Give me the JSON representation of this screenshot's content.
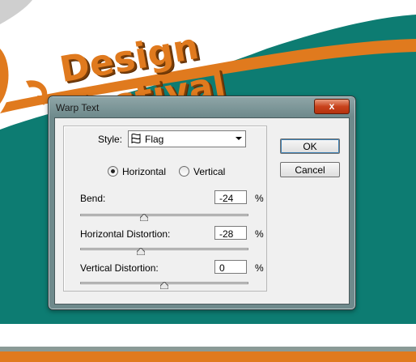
{
  "banner": {
    "title": "Design Festival"
  },
  "colors": {
    "teal": "#0d7c72",
    "orange": "#e07a1e",
    "dialog_frame": "#6f8a8c"
  },
  "dialog": {
    "title": "Warp Text",
    "close_glyph": "x",
    "style_label": "Style:",
    "style_value": "Flag",
    "style_icon": "flag-icon",
    "orientation": {
      "options": [
        "Horizontal",
        "Vertical"
      ],
      "selected": "Horizontal"
    },
    "fields": [
      {
        "label": "Bend:",
        "value": "-24",
        "unit": "%",
        "slider_percent": -24
      },
      {
        "label": "Horizontal Distortion:",
        "value": "-28",
        "unit": "%",
        "slider_percent": -28
      },
      {
        "label": "Vertical Distortion:",
        "value": "0",
        "unit": "%",
        "slider_percent": 0
      }
    ],
    "ok_label": "OK",
    "cancel_label": "Cancel"
  }
}
